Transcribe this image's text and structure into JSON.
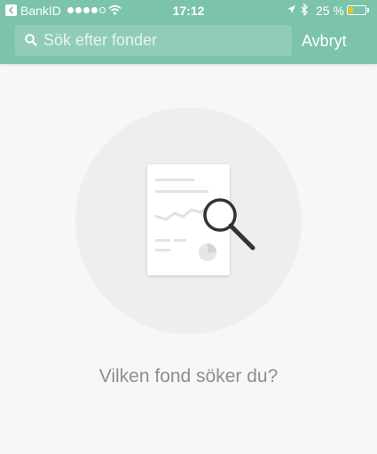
{
  "status_bar": {
    "back_app": "BankID",
    "time": "17:12",
    "battery_percent": "25 %",
    "battery_level": 0.25,
    "signal_bars_filled": 4,
    "signal_bars_total": 5
  },
  "search": {
    "placeholder": "Sök efter fonder",
    "value": "",
    "cancel_label": "Avbryt"
  },
  "empty_state": {
    "prompt": "Vilken fond söker du?"
  },
  "colors": {
    "header": "#7cc4a9",
    "background": "#f7f7f7",
    "circle": "#eeeeee",
    "battery": "#f0c419"
  }
}
